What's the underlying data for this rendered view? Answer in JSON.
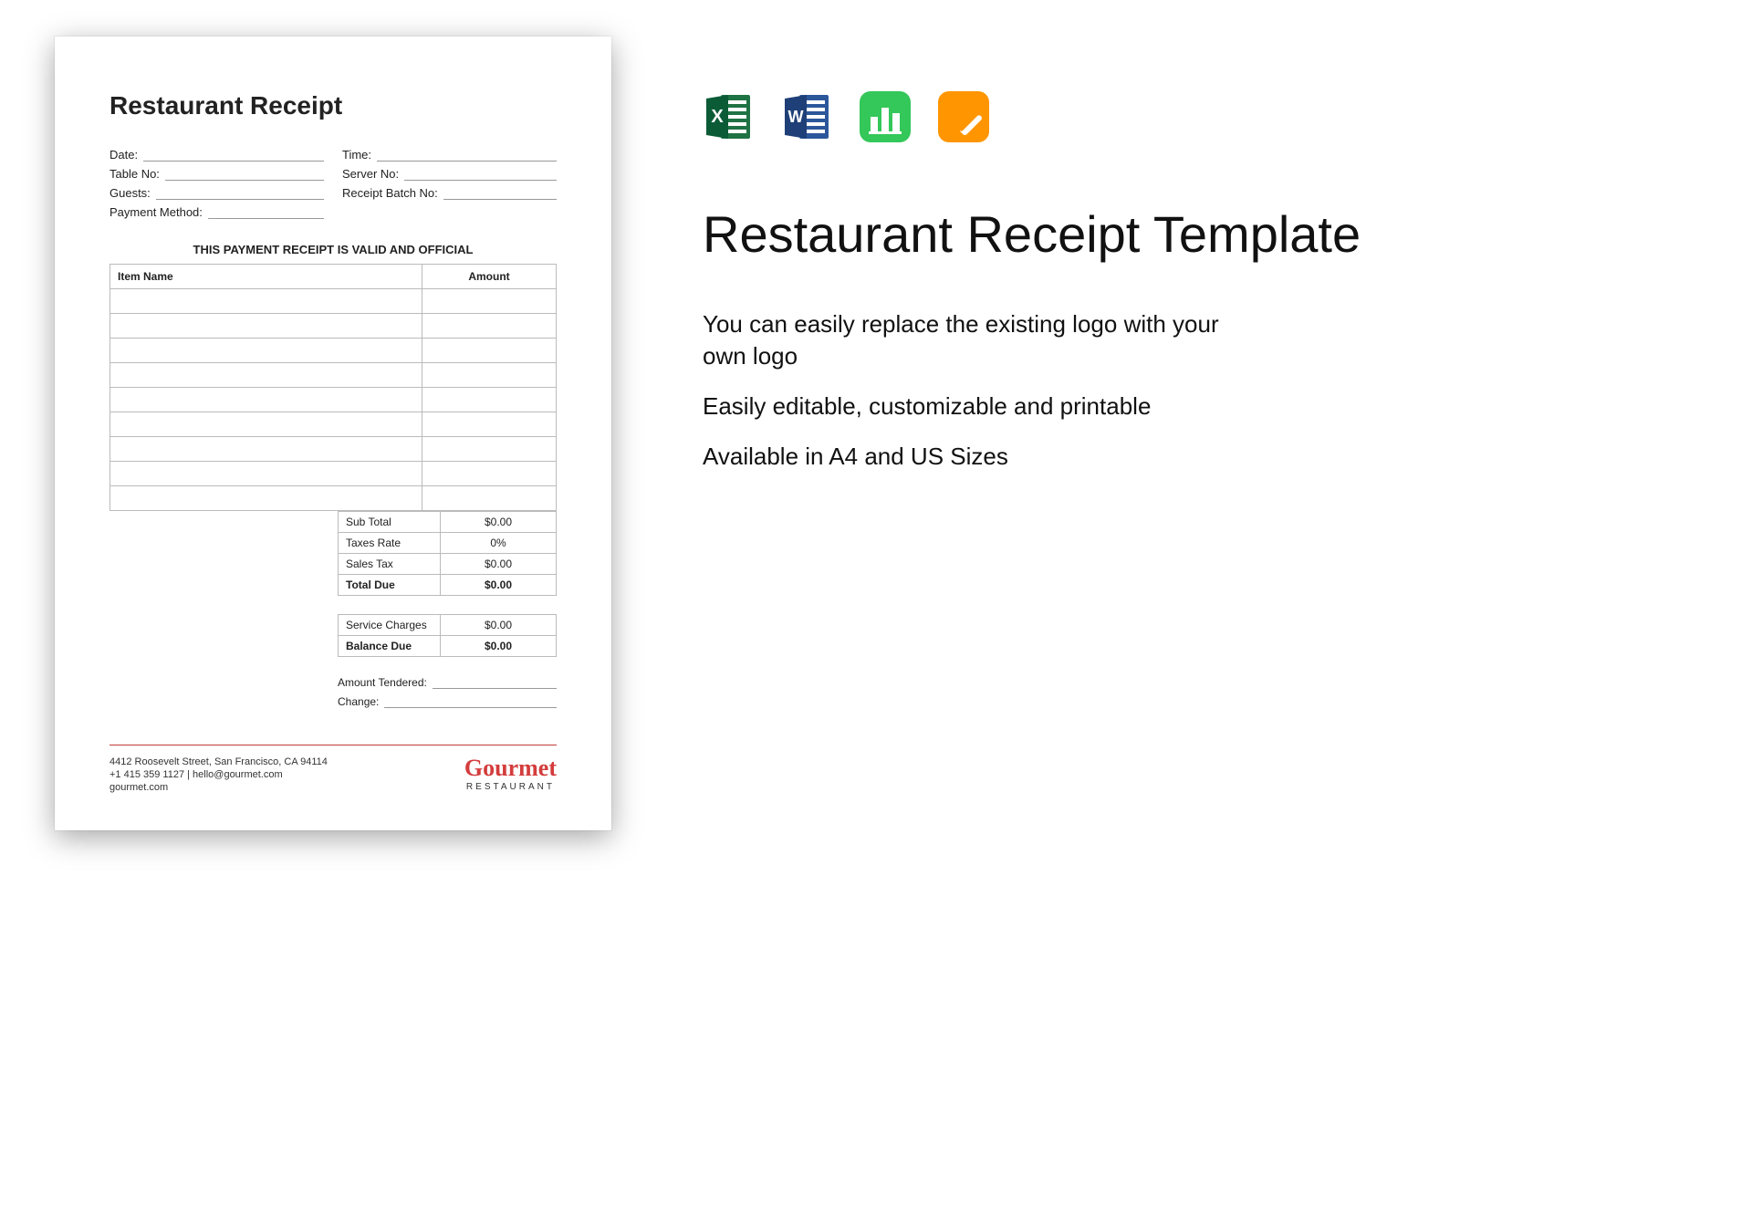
{
  "receipt": {
    "title": "Restaurant Receipt",
    "fields": {
      "date": "Date:",
      "time": "Time:",
      "table_no": "Table No:",
      "server_no": "Server No:",
      "guests": "Guests:",
      "receipt_batch_no": "Receipt Batch No:",
      "payment_method": "Payment Method:"
    },
    "valid_notice": "THIS PAYMENT RECEIPT IS VALID AND OFFICIAL",
    "columns": {
      "item": "Item Name",
      "amount": "Amount"
    },
    "totals": {
      "subtotal_label": "Sub Total",
      "subtotal_value": "$0.00",
      "taxrate_label": "Taxes Rate",
      "taxrate_value": "0%",
      "salestax_label": "Sales Tax",
      "salestax_value": "$0.00",
      "totaldue_label": "Total Due",
      "totaldue_value": "$0.00",
      "service_label": "Service Charges",
      "service_value": "$0.00",
      "balance_label": "Balance Due",
      "balance_value": "$0.00"
    },
    "tendered_label": "Amount Tendered:",
    "change_label": "Change:",
    "footer": {
      "address": "4412 Roosevelt Street, San Francisco, CA 94114",
      "contact": "+1 415 359 1127 | hello@gourmet.com",
      "site": "gourmet.com",
      "logo_name": "Gourmet",
      "logo_sub": "RESTAURANT"
    }
  },
  "side": {
    "title": "Restaurant Receipt Template",
    "features": [
      "You can easily replace the existing logo with your own logo",
      "Easily editable, customizable and printable",
      "Available in A4 and US Sizes"
    ],
    "icons": [
      "excel-icon",
      "word-icon",
      "numbers-icon",
      "pages-icon"
    ]
  }
}
